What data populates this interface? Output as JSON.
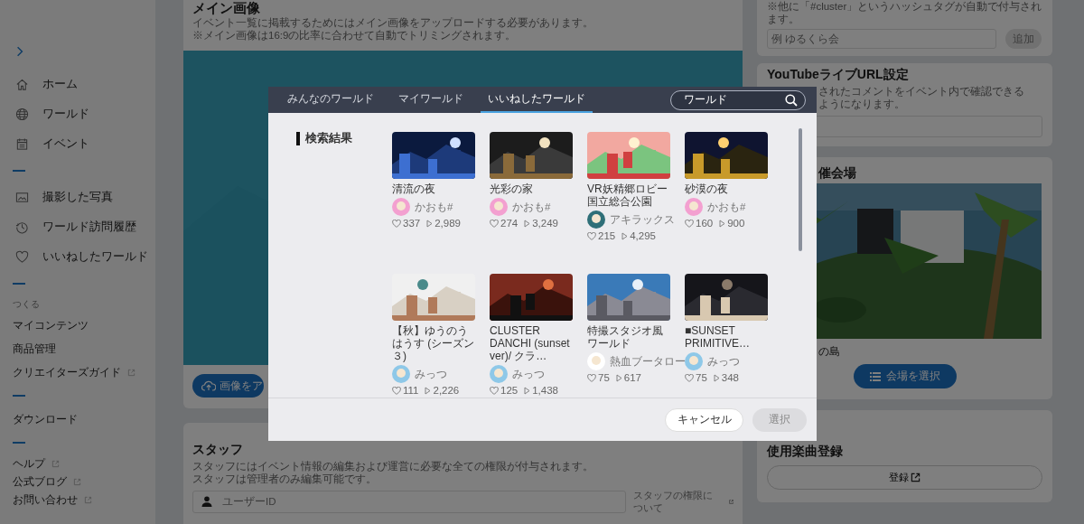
{
  "sidebar": {
    "groups": [
      {
        "items": [
          {
            "label": "ホーム",
            "kind": "nav",
            "external": false
          },
          {
            "label": "ワールド",
            "kind": "nav",
            "external": false
          },
          {
            "label": "イベント",
            "kind": "nav",
            "external": false
          }
        ]
      },
      {
        "items": [
          {
            "label": "撮影した写真",
            "kind": "nav",
            "external": false
          },
          {
            "label": "ワールド訪問履歴",
            "kind": "nav",
            "external": false
          },
          {
            "label": "いいねしたワールド",
            "kind": "nav",
            "external": false
          }
        ]
      },
      {
        "heading": "つくる",
        "items": [
          {
            "label": "マイコンテンツ",
            "kind": "link",
            "external": false
          },
          {
            "label": "商品管理",
            "kind": "link",
            "external": false
          },
          {
            "label": "クリエイターズガイド",
            "kind": "link",
            "external": true
          }
        ]
      },
      {
        "items": [
          {
            "label": "ダウンロード",
            "kind": "link",
            "external": false
          }
        ]
      },
      {
        "items": [
          {
            "label": "ヘルプ",
            "kind": "small",
            "external": true
          },
          {
            "label": "公式ブログ",
            "kind": "small",
            "external": true
          },
          {
            "label": "お問い合わせ",
            "kind": "small",
            "external": true
          }
        ]
      }
    ]
  },
  "main_image": {
    "title": "メイン画像",
    "description": [
      "イベント一覧に掲載するためにはメイン画像をアップロードする必要があります。",
      "※メイン画像は16:9の比率に合わせて自動でトリミングされます。"
    ],
    "upload_button": "画像をア"
  },
  "staff": {
    "title": "スタッフ",
    "description": [
      "スタッフにはイベント情報の編集および運営に必要な全ての権限が付与されます。",
      "スタッフは管理者のみ編集可能です。"
    ],
    "user_field": {
      "placeholder": "ユーザーID"
    },
    "permissions_link": "スタッフの権限について"
  },
  "hashtag": {
    "note": "※他に「#cluster」というハッシュタグが自動で付与されます。",
    "field": {
      "placeholder": "例 ゆるくら会"
    },
    "add_button": {
      "label": "追加",
      "disabled": true
    }
  },
  "youtube": {
    "title": "YouTubeライブURL設定",
    "description": "されたコメントをイベント内で確認できるようになります。"
  },
  "venue": {
    "title": "催会場",
    "name": "の島",
    "select_button": "会場を選択"
  },
  "music": {
    "title": "使用楽曲登録",
    "register_button": "登録"
  },
  "modal": {
    "tabs": [
      {
        "label": "みんなのワールド",
        "selected": false
      },
      {
        "label": "マイワールド",
        "selected": false
      },
      {
        "label": "いいねしたワールド",
        "selected": true
      }
    ],
    "search": {
      "value": "ワールド"
    },
    "section_title": "検索結果",
    "worlds": [
      {
        "title": "清流の夜",
        "author": "かおも#",
        "likes": "337",
        "plays": "2,989"
      },
      {
        "title": "光彩の家",
        "author": "かおも#",
        "likes": "274",
        "plays": "3,249"
      },
      {
        "title": "VR妖精郷ロビー国立総合公園",
        "author": "アキラックス",
        "likes": "215",
        "plays": "4,295"
      },
      {
        "title": "砂漠の夜",
        "author": "かおも#",
        "likes": "160",
        "plays": "900"
      },
      {
        "title": "【秋】ゆうのうはうす (シーズン３)",
        "author": "みっつ",
        "likes": "111",
        "plays": "2,226"
      },
      {
        "title": "CLUSTER DANCHI (sunset ver)/ クラ…",
        "author": "みっつ",
        "likes": "125",
        "plays": "1,438"
      },
      {
        "title": "特撮スタジオ風ワールド",
        "author": "熱血ブータロー",
        "likes": "75",
        "plays": "617"
      },
      {
        "title": "■SUNSET PRIMITIVE…",
        "author": "みっつ",
        "likes": "75",
        "plays": "348"
      }
    ],
    "buttons": [
      {
        "label": "キャンセル",
        "kind": "cancel",
        "disabled": false
      },
      {
        "label": "選択",
        "kind": "primary",
        "disabled": true
      }
    ]
  }
}
